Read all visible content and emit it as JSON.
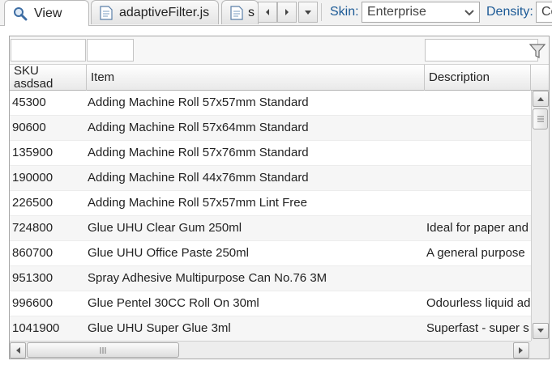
{
  "toolbar": {
    "tabs": [
      {
        "label": "View",
        "icon": "search-icon"
      },
      {
        "label": "adaptiveFilter.js",
        "icon": "document-icon"
      },
      {
        "label": "s",
        "icon": "document-icon"
      }
    ],
    "skin_label": "Skin:",
    "skin_value": "Enterprise",
    "density_label": "Density:",
    "density_value": "Co"
  },
  "grid": {
    "columns": [
      {
        "label": "SKU\nasdsad"
      },
      {
        "label": "Item"
      },
      {
        "label": "Description"
      }
    ],
    "rows": [
      {
        "sku": "45300",
        "item": "Adding Machine Roll 57x57mm Standard",
        "description": ""
      },
      {
        "sku": "90600",
        "item": "Adding Machine Roll 57x64mm Standard",
        "description": ""
      },
      {
        "sku": "135900",
        "item": "Adding Machine Roll 57x76mm Standard",
        "description": ""
      },
      {
        "sku": "190000",
        "item": "Adding Machine Roll 44x76mm Standard",
        "description": ""
      },
      {
        "sku": "226500",
        "item": "Adding Machine Roll 57x57mm Lint Free",
        "description": ""
      },
      {
        "sku": "724800",
        "item": "Glue UHU Clear Gum 250ml",
        "description": "Ideal for paper and"
      },
      {
        "sku": "860700",
        "item": "Glue UHU Office Paste 250ml",
        "description": "A general purpose"
      },
      {
        "sku": "951300",
        "item": "Spray Adhesive Multipurpose Can No.76 3M",
        "description": ""
      },
      {
        "sku": "996600",
        "item": "Glue Pentel 30CC Roll On 30ml",
        "description": "Odourless liquid ad"
      },
      {
        "sku": "1041900",
        "item": "Glue UHU Super Glue 3ml",
        "description": "Superfast - super s"
      }
    ]
  }
}
